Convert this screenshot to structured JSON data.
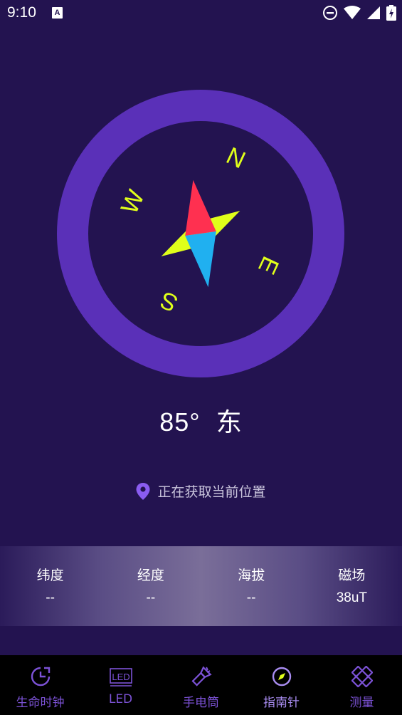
{
  "status_bar": {
    "time": "9:10",
    "notification_badge": "A"
  },
  "compass": {
    "ring_color": "#5a30b8",
    "needle_north_color": "#ff3050",
    "needle_south_color": "#20b0f0",
    "star_color": "#e0ff1a",
    "directions": {
      "n": "N",
      "e": "E",
      "s": "S",
      "w": "W"
    }
  },
  "heading": {
    "degrees": "85°",
    "direction": "东"
  },
  "location": {
    "icon": "location-pin-icon",
    "status": "正在获取当前位置"
  },
  "stats": [
    {
      "label": "纬度",
      "value": "--"
    },
    {
      "label": "经度",
      "value": "--"
    },
    {
      "label": "海拔",
      "value": "--"
    },
    {
      "label": "磁场",
      "value": "38uT"
    }
  ],
  "nav": [
    {
      "label": "生命时钟",
      "icon": "clock-icon"
    },
    {
      "label": "LED",
      "icon": "led-icon"
    },
    {
      "label": "手电筒",
      "icon": "flashlight-icon"
    },
    {
      "label": "指南针",
      "icon": "compass-icon"
    },
    {
      "label": "测量",
      "icon": "ruler-icon"
    }
  ],
  "active_tab": "指南针",
  "colors": {
    "background": "#231350",
    "accent": "#7c52d6"
  }
}
